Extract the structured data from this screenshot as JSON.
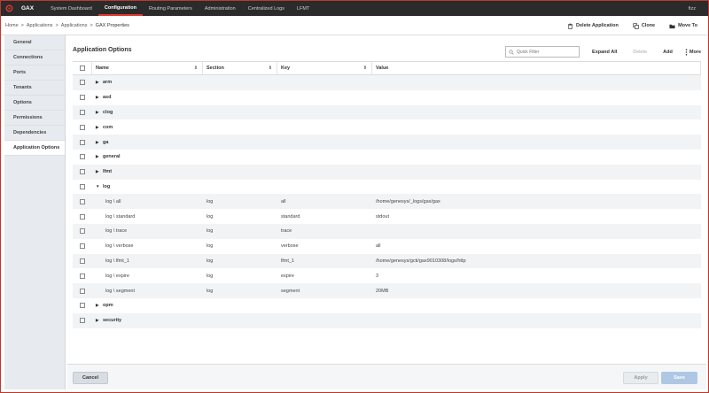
{
  "app": {
    "name": "GAX",
    "nav": [
      "System Dashboard",
      "Configuration",
      "Routing Parameters",
      "Administration",
      "Centralized Logs",
      "LFMT"
    ],
    "active_nav_index": 1,
    "user": "fizz"
  },
  "breadcrumb": [
    "Home",
    "Applications",
    "Applications",
    "GAX Properties"
  ],
  "page_actions": {
    "delete": "Delete Application",
    "clone": "Clone",
    "move": "Move To"
  },
  "sidebar": {
    "items": [
      "General",
      "Connections",
      "Ports",
      "Tenants",
      "Options",
      "Permissions",
      "Dependencies",
      "Application Options"
    ],
    "active_index": 7
  },
  "main": {
    "title": "Application Options",
    "filter_placeholder": "Quick Filter",
    "expand_all": "Expand All",
    "delete": "Delete",
    "add": "Add",
    "more": "More"
  },
  "grid": {
    "columns": [
      "Name",
      "Section",
      "Key",
      "Value"
    ],
    "rows": [
      {
        "type": "group",
        "name": "arm",
        "expanded": false
      },
      {
        "type": "group",
        "name": "asd",
        "expanded": false
      },
      {
        "type": "group",
        "name": "clog",
        "expanded": false
      },
      {
        "type": "group",
        "name": "com",
        "expanded": false
      },
      {
        "type": "group",
        "name": "ga",
        "expanded": false
      },
      {
        "type": "group",
        "name": "general",
        "expanded": false
      },
      {
        "type": "group",
        "name": "lfmt",
        "expanded": false
      },
      {
        "type": "group",
        "name": "log",
        "expanded": true
      },
      {
        "type": "child",
        "name": "log \\ all",
        "section": "log",
        "key": "all",
        "value": "/home/genesys/_logs/gax/gax"
      },
      {
        "type": "child",
        "name": "log \\ standard",
        "section": "log",
        "key": "standard",
        "value": "stdout"
      },
      {
        "type": "child",
        "name": "log \\ trace",
        "section": "log",
        "key": "trace",
        "value": ""
      },
      {
        "type": "child",
        "name": "log \\ verbose",
        "section": "log",
        "key": "verbose",
        "value": "all"
      },
      {
        "type": "child",
        "name": "log \\ lfmt_1",
        "section": "log",
        "key": "lfmt_1",
        "value": "/home/genesys/gcti/gax9010308/logs/http"
      },
      {
        "type": "child",
        "name": "log \\ expire",
        "section": "log",
        "key": "expire",
        "value": "3"
      },
      {
        "type": "child",
        "name": "log \\ segment",
        "section": "log",
        "key": "segment",
        "value": "20MB"
      },
      {
        "type": "group",
        "name": "opm",
        "expanded": false
      },
      {
        "type": "group",
        "name": "security",
        "expanded": false
      }
    ]
  },
  "footer": {
    "cancel": "Cancel",
    "apply": "Apply",
    "save": "Save"
  },
  "colors": {
    "topbar": "#2b2b2b",
    "accent": "#e03a2f",
    "save_button": "#aec8e4",
    "sidebar": "#e7eaee"
  }
}
